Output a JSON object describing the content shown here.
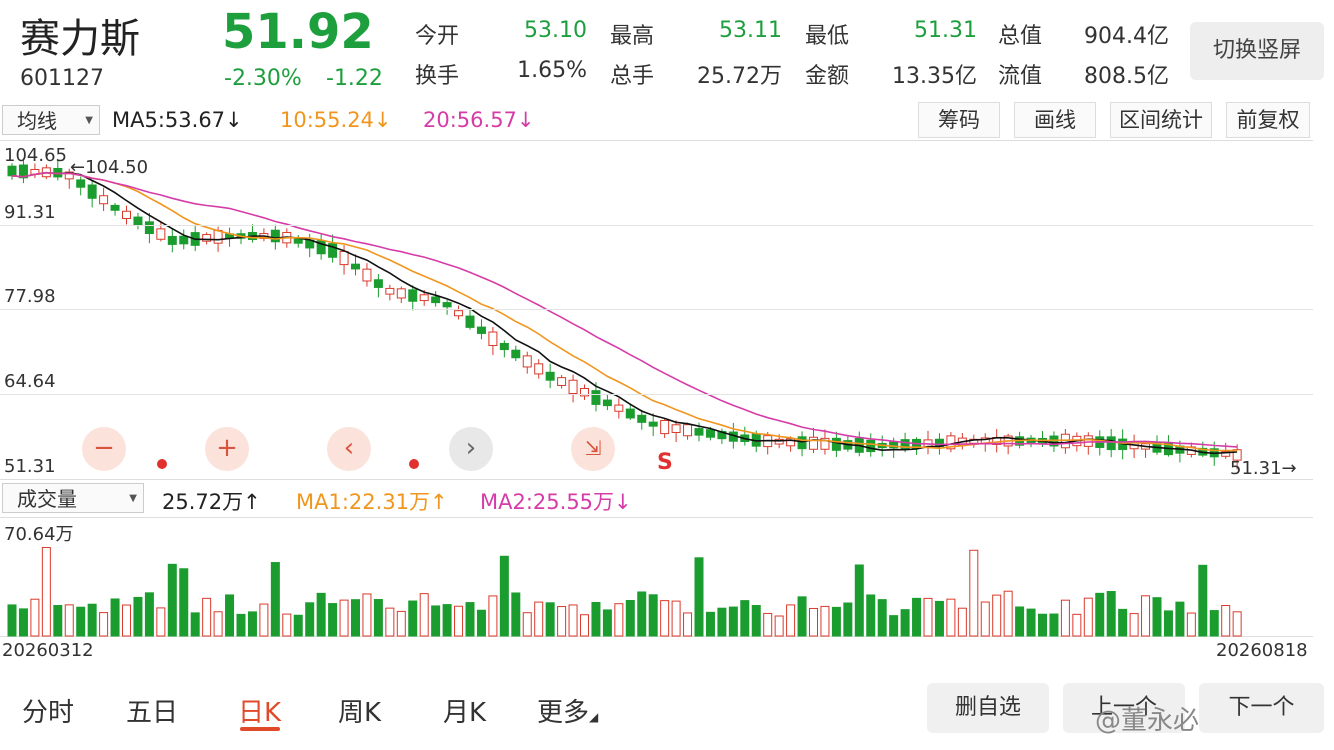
{
  "stock": {
    "name": "赛力斯",
    "code": "601127",
    "price": "51.92",
    "change_pct": "-2.30%",
    "change_amt": "-1.22"
  },
  "quote": [
    {
      "label": "今开",
      "value": "53.10",
      "color": "#1e9f3e"
    },
    {
      "label": "最高",
      "value": "53.11",
      "color": "#1e9f3e"
    },
    {
      "label": "最低",
      "value": "51.31",
      "color": "#1e9f3e"
    },
    {
      "label": "总值",
      "value": "904.4亿",
      "color": "#333333"
    },
    {
      "label": "换手",
      "value": "1.65%",
      "color": "#333333"
    },
    {
      "label": "总手",
      "value": "25.72万",
      "color": "#333333"
    },
    {
      "label": "金额",
      "value": "13.35亿",
      "color": "#333333"
    },
    {
      "label": "流值",
      "value": "808.5亿",
      "color": "#333333"
    }
  ],
  "switch_label": "切换竖屏",
  "ma_bar": {
    "select": "均线",
    "ma5": "MA5:53.67",
    "ma10": "10:55.24",
    "ma20": "20:56.57",
    "arrow": "↓"
  },
  "tools": [
    "筹码",
    "画线",
    "区间统计",
    "前复权"
  ],
  "price_axis": [
    "104.65",
    "91.31",
    "77.98",
    "64.64",
    "51.31"
  ],
  "price_annotations": {
    "high": "104.50",
    "low": "51.31"
  },
  "vol_bar": {
    "select": "成交量",
    "vol": "25.72万",
    "vol_arrow": "↑",
    "ma1": "MA1:22.31万",
    "ma1_arrow": "↑",
    "ma2": "MA2:25.55万",
    "ma2_arrow": "↓"
  },
  "vol_axis_top": "70.64万",
  "date_start": "20260312",
  "date_end": "20260818",
  "controls": {
    "zoom_out": "−",
    "zoom_in": "+",
    "prev": "‹",
    "next": "›",
    "collapse_icon": "shrink-arrows-icon",
    "s_label": "S"
  },
  "tabs": [
    "分时",
    "五日",
    "日K",
    "周K",
    "月K",
    "更多"
  ],
  "active_tab": "日K",
  "bottom_buttons": [
    "删自选",
    "上一个",
    "下一个"
  ],
  "watermark": "@董永必",
  "colors": {
    "up": "#d93a2b",
    "down": "#1a9c2e",
    "ma5": "#111111",
    "ma10": "#f0961e",
    "ma20": "#d63ca8"
  }
}
